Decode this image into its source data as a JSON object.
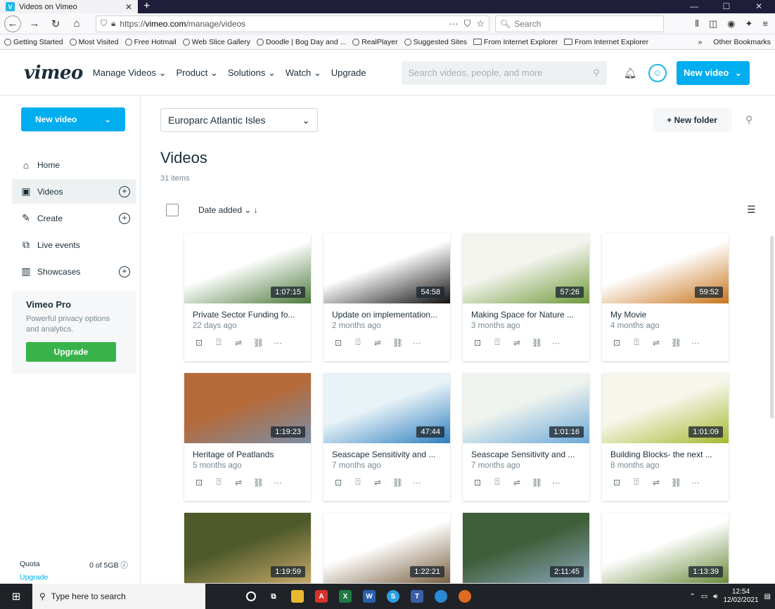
{
  "browser": {
    "tab_title": "Videos on Vimeo",
    "url_prefix": "https://",
    "url_host": "vimeo.com",
    "url_path": "/manage/videos",
    "search_placeholder": "Search",
    "bookmarks": [
      "Getting Started",
      "Most Visited",
      "Free Hotmail",
      "Web Slice Gallery",
      "Doodle | Bog Day and ...",
      "RealPlayer",
      "Suggested Sites",
      "From Internet Explorer",
      "From Internet Explorer"
    ],
    "other_bookmarks": "Other Bookmarks"
  },
  "header": {
    "logo": "vimeo",
    "nav": [
      "Manage Videos",
      "Product",
      "Solutions",
      "Watch",
      "Upgrade"
    ],
    "search_placeholder": "Search videos, people, and more",
    "new_video_label": "New video"
  },
  "sidebar": {
    "new_video_label": "New video",
    "items": [
      {
        "label": "Home",
        "icon": "home-icon"
      },
      {
        "label": "Videos",
        "icon": "videos-icon"
      },
      {
        "label": "Create",
        "icon": "create-icon"
      },
      {
        "label": "Live events",
        "icon": "live-icon"
      },
      {
        "label": "Showcases",
        "icon": "showcase-icon"
      }
    ],
    "pro": {
      "title": "Vimeo Pro",
      "description": "Powerful privacy options and analytics.",
      "button": "Upgrade"
    },
    "quota": {
      "label": "Quota",
      "value": "0 of 5GB",
      "upgrade": "Upgrade"
    }
  },
  "main": {
    "folder": "Europarc Atlantic Isles",
    "new_folder": "+ New folder",
    "title": "Videos",
    "count": "31 items",
    "sort_label": "Date added",
    "videos": [
      {
        "title": "Private Sector Funding fo...",
        "date": "22 days ago",
        "duration": "1:07:15",
        "thumb_colors": [
          "#ffffff",
          "#4c7a3c"
        ]
      },
      {
        "title": "Update on implementation...",
        "date": "2 months ago",
        "duration": "54:58",
        "thumb_colors": [
          "#ffffff",
          "#111111"
        ]
      },
      {
        "title": "Making Space for Nature ...",
        "date": "3 months ago",
        "duration": "57:26",
        "thumb_colors": [
          "#f4f4ee",
          "#6f9a3a"
        ]
      },
      {
        "title": "My Movie",
        "date": "4 months ago",
        "duration": "59:52",
        "thumb_colors": [
          "#ffffff",
          "#c8741c"
        ]
      },
      {
        "title": "Heritage of Peatlands",
        "date": "5 months ago",
        "duration": "1:19:23",
        "thumb_colors": [
          "#b56a3a",
          "#7a8fa8"
        ]
      },
      {
        "title": "Seascape Sensitivity and ...",
        "date": "7 months ago",
        "duration": "47:44",
        "thumb_colors": [
          "#e8f3f8",
          "#2f7fbf"
        ]
      },
      {
        "title": "Seascape Sensitivity and ...",
        "date": "7 months ago",
        "duration": "1:01:16",
        "thumb_colors": [
          "#eef3ee",
          "#6aa8d8"
        ]
      },
      {
        "title": "Building Blocks- the next ...",
        "date": "8 months ago",
        "duration": "1:01:09",
        "thumb_colors": [
          "#f6f6ea",
          "#a5b930"
        ]
      },
      {
        "title": "",
        "date": "",
        "duration": "1:19:59",
        "thumb_colors": [
          "#4e5a2a",
          "#c7a86a"
        ]
      },
      {
        "title": "",
        "date": "",
        "duration": "1:22:21",
        "thumb_colors": [
          "#ffffff",
          "#7a6040"
        ]
      },
      {
        "title": "",
        "date": "",
        "duration": "2:11:45",
        "thumb_colors": [
          "#3f5f3a",
          "#8aa6b8"
        ]
      },
      {
        "title": "",
        "date": "",
        "duration": "1:13:39",
        "thumb_colors": [
          "#ffffff",
          "#6a8a3a"
        ]
      }
    ]
  },
  "taskbar": {
    "search_placeholder": "Type here to search",
    "time": "12:54",
    "date": "12/02/2021"
  },
  "colors": {
    "accent": "#00adef",
    "upgrade_green": "#38b34a",
    "text": "#1a2e3b"
  }
}
